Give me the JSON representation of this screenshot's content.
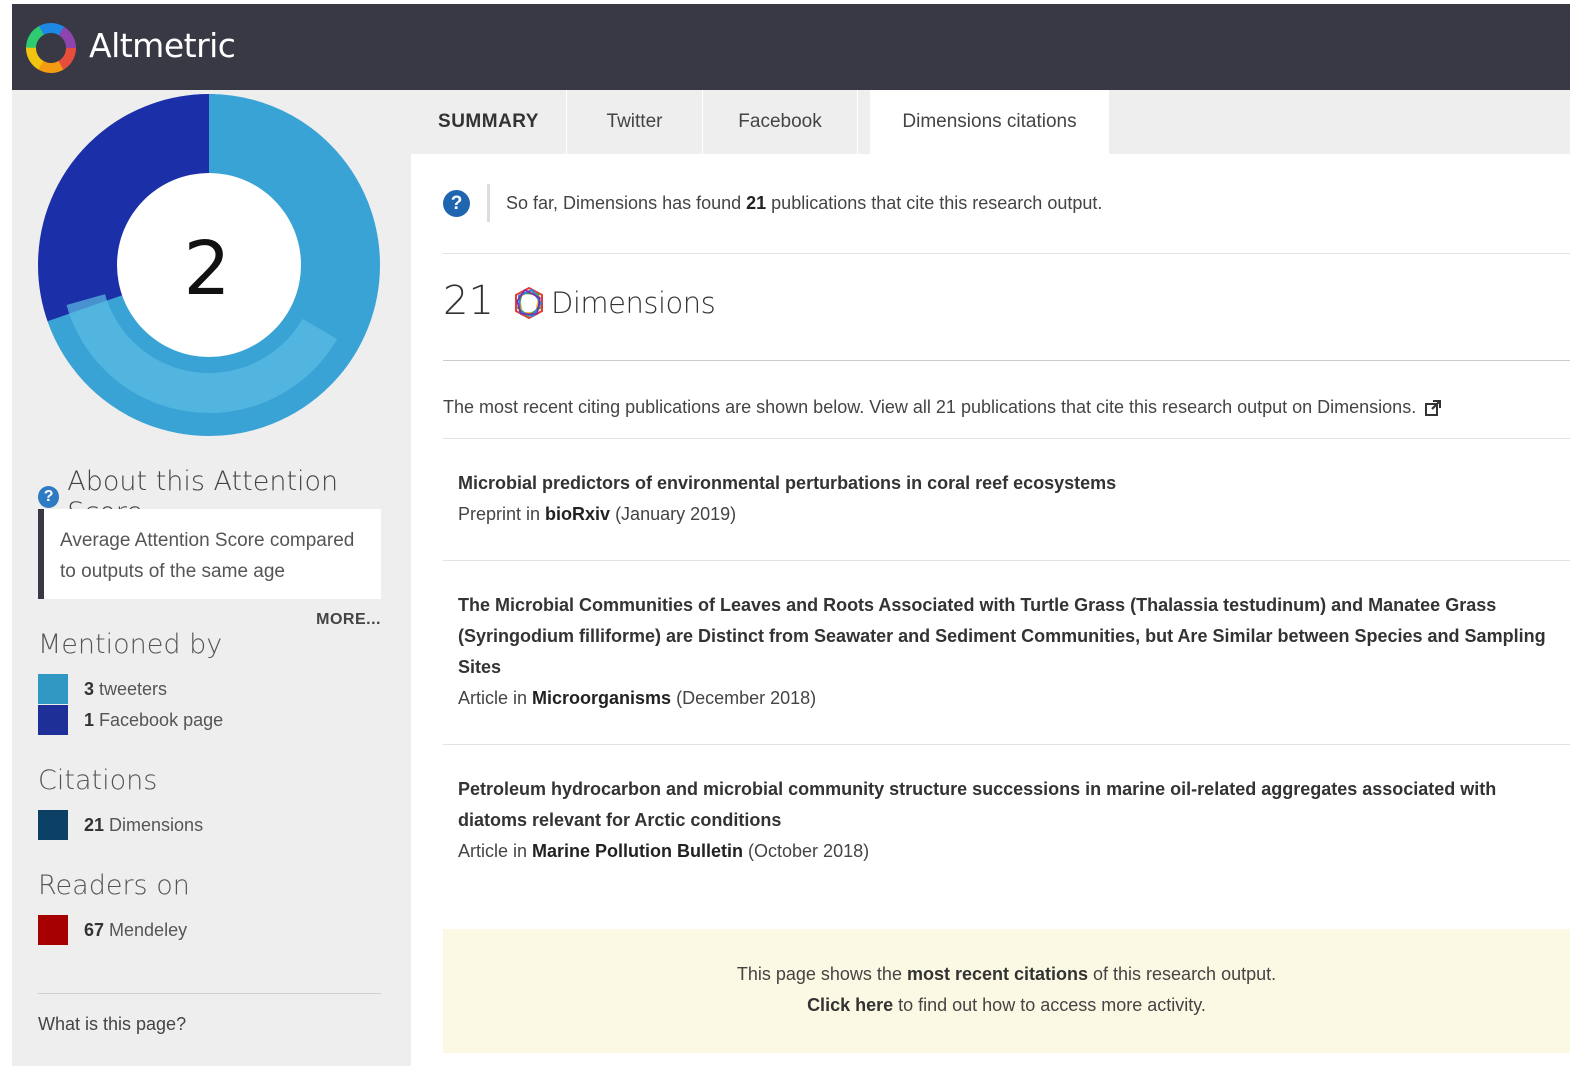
{
  "header": {
    "brand": "Altmetric"
  },
  "sidebar": {
    "score": "2",
    "about_title": "About this Attention Score",
    "about_text": "Average Attention Score compared to outputs of the same age",
    "more_label": "MORE...",
    "mentioned_title": "Mentioned by",
    "mentions": [
      {
        "count": "3",
        "label": "tweeters",
        "color": "#3198c4"
      },
      {
        "count": "1",
        "label": "Facebook page",
        "color": "#1f2f98"
      }
    ],
    "citations_title": "Citations",
    "citations": [
      {
        "count": "21",
        "label": "Dimensions",
        "color": "#0c4165"
      }
    ],
    "readers_title": "Readers on",
    "readers": [
      {
        "count": "67",
        "label": "Mendeley",
        "color": "#a60000"
      }
    ],
    "what_label": "What is this page?"
  },
  "tabs": [
    {
      "label": "SUMMARY"
    },
    {
      "label": "Twitter"
    },
    {
      "label": "Facebook"
    },
    {
      "label": "Dimensions citations"
    }
  ],
  "main": {
    "intro_prefix": "So far, Dimensions has found ",
    "intro_count": "21",
    "intro_suffix": " publications that cite this research output.",
    "count": "21",
    "dimensions_word": "Dimensions",
    "recent_text": "The most recent citing publications are shown below. View all 21 publications that cite this research output on Dimensions.",
    "publications": [
      {
        "title": "Microbial predictors of environmental perturbations in coral reef ecosystems",
        "type": "Preprint in ",
        "venue": "bioRxiv",
        "date": " (January 2019)"
      },
      {
        "title": "The Microbial Communities of Leaves and Roots Associated with Turtle Grass (Thalassia testudinum) and Manatee Grass (Syringodium filliforme) are Distinct from Seawater and Sediment Communities, but Are Similar between Species and Sampling Sites",
        "type": "Article in ",
        "venue": "Microorganisms",
        "date": " (December 2018)"
      },
      {
        "title": "Petroleum hydrocarbon and microbial community structure successions in marine oil-related aggregates associated with diatoms relevant for Arctic conditions",
        "type": "Article in ",
        "venue": "Marine Pollution Bulletin",
        "date": " (October 2018)"
      }
    ],
    "notice": {
      "line1_prefix": "This page shows the ",
      "line1_bold": "most recent citations",
      "line1_suffix": " of this research output.",
      "line2_bold": "Click here",
      "line2_suffix": " to find out how to access more activity."
    }
  }
}
